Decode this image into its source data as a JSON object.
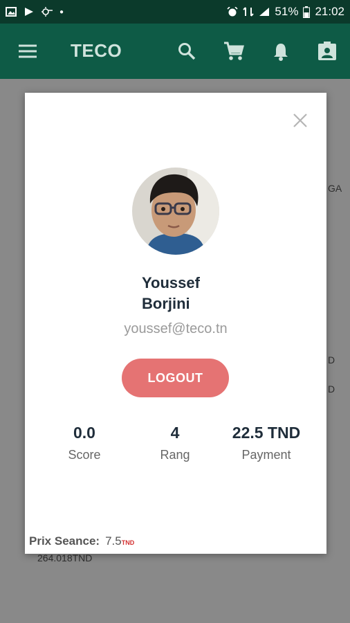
{
  "status_bar": {
    "battery": "51%",
    "time": "21:02"
  },
  "app_bar": {
    "title": "TECO",
    "icons": [
      "menu-icon",
      "search-icon",
      "cart-icon",
      "bell-icon",
      "account-box-icon"
    ]
  },
  "background": {
    "partial_texts": [
      "GA",
      "D",
      "D",
      "264.018TND"
    ]
  },
  "profile": {
    "first_name": "Youssef",
    "last_name": "Borjini",
    "email": "youssef@teco.tn",
    "logout_label": "LOGOUT",
    "stats": [
      {
        "value": "0.0",
        "label": "Score"
      },
      {
        "value": "4",
        "label": "Rang"
      },
      {
        "value": "22.5 TND",
        "label": "Payment"
      }
    ],
    "prix_label": "Prix Seance:",
    "prix_value": "7.5",
    "prix_unit": "TND"
  },
  "colors": {
    "primary": "#0e5b46",
    "status": "#0b3a2b",
    "accent": "#e57373"
  }
}
